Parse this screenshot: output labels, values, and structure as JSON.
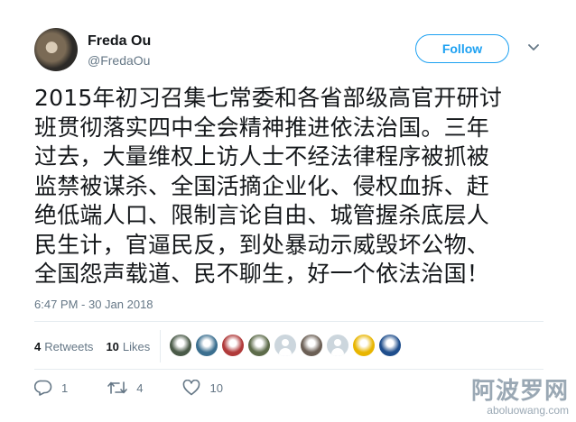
{
  "author": {
    "name": "Freda Ou",
    "handle": "@FredaOu",
    "follow_label": "Follow"
  },
  "tweet": {
    "lines": [
      "2015年初习召集七常委和各省部级高官开研讨",
      "班贯彻落实四中全会精神推进依法治国。三年",
      "过去，大量维权上访人士不经法律程序被抓被",
      "监禁被谋杀、全国活摘企业化、侵权血拆、赶",
      "绝低端人口、限制言论自由、城管握杀底层人",
      "民生计，官逼民反，到处暴动示威毁坏公物、",
      "全国怨声载道、民不聊生，好一个依法治国！"
    ],
    "timestamp": "6:47 PM - 30 Jan 2018"
  },
  "stats": {
    "retweets_count": "4",
    "retweets_label": "Retweets",
    "likes_count": "10",
    "likes_label": "Likes"
  },
  "likers": [
    {
      "name": "liker-avatar-1",
      "color": "#4a5a48"
    },
    {
      "name": "liker-avatar-2",
      "color": "#3b6f8f"
    },
    {
      "name": "liker-avatar-3",
      "color": "#b03a3a"
    },
    {
      "name": "liker-avatar-4",
      "color": "#5d6b4a"
    },
    {
      "name": "liker-avatar-5",
      "color": "default"
    },
    {
      "name": "liker-avatar-6",
      "color": "#6b5f55"
    },
    {
      "name": "liker-avatar-7",
      "color": "default"
    },
    {
      "name": "liker-avatar-8",
      "color": "#e8b500"
    },
    {
      "name": "liker-avatar-9",
      "color": "#1f4e8c"
    }
  ],
  "actions": {
    "reply_count": "1",
    "retweet_count": "4",
    "like_count": "10"
  },
  "watermark": {
    "title": "阿波罗网",
    "url": "aboluowang.com"
  },
  "colors": {
    "accent": "#1da1f2",
    "secondary_text": "#657786",
    "border": "#e6ecf0"
  }
}
